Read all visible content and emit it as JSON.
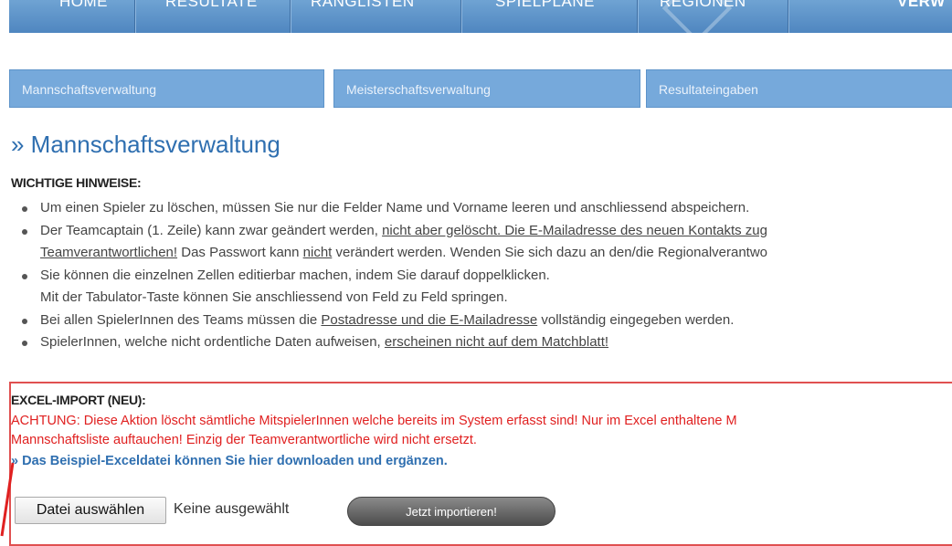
{
  "topnav": {
    "items": [
      "HOME",
      "RESULTATE",
      "RANGLISTEN",
      "SPIELPLÄNE",
      "REGIONEN",
      "VERW"
    ]
  },
  "subtabs": [
    "Mannschaftsverwaltung",
    "Meisterschaftsverwaltung",
    "Resultateingaben"
  ],
  "page": {
    "title": "» Mannschaftsverwaltung",
    "notes_heading": "WICHTIGE HINWEISE:",
    "notes": [
      {
        "t1": "Um einen Spieler zu löschen, müssen Sie nur die Felder Name und Vorname leeren und anschliessend abspeichern."
      },
      {
        "t1": "Der Teamcaptain (1. Zeile) kann zwar geändert werden, ",
        "u1": "nicht aber gelöscht. Die E-Mailadresse des neuen Kontakts zug",
        "u2": "Teamverantwortlichen!",
        "t2": " Das Passwort kann ",
        "u3": "nicht",
        "t3": " verändert werden. Wenden Sie sich dazu an den/die Regionalverantwo"
      },
      {
        "t1": "Sie können die einzelnen Zellen editierbar machen, indem Sie darauf doppelklicken.",
        "t2": "Mit der Tabulator-Taste können Sie anschliessend von Feld zu Feld springen."
      },
      {
        "t1": "Bei allen SpielerInnen des Teams müssen die ",
        "u1": "Postadresse und die E-Mailadresse",
        "t2": " vollständig eingegeben werden."
      },
      {
        "t1": "SpielerInnen, welche nicht ordentliche Daten aufweisen, ",
        "u1": "erscheinen nicht auf dem Matchblatt!"
      }
    ]
  },
  "excel": {
    "heading": "EXCEL-IMPORT (NEU):",
    "warning_line1": "ACHTUNG: Diese Aktion löscht sämtliche MitspielerInnen welche bereits im System erfasst sind! Nur im Excel enthaltene M",
    "warning_line2": "Mannschaftsliste auftauchen! Einzig der Teamverantwortliche wird nicht ersetzt.",
    "download_link": "» Das Beispiel-Exceldatei können Sie hier downloaden und ergänzen.",
    "file_button": "Datei auswählen",
    "file_status": "Keine ausgewählt",
    "import_button": "Jetzt importieren!"
  },
  "colors": {
    "nav": "#5b91c8",
    "tab": "#76a9db",
    "title": "#2f6fb0",
    "warning": "#e02020",
    "box_border": "#e05050"
  }
}
